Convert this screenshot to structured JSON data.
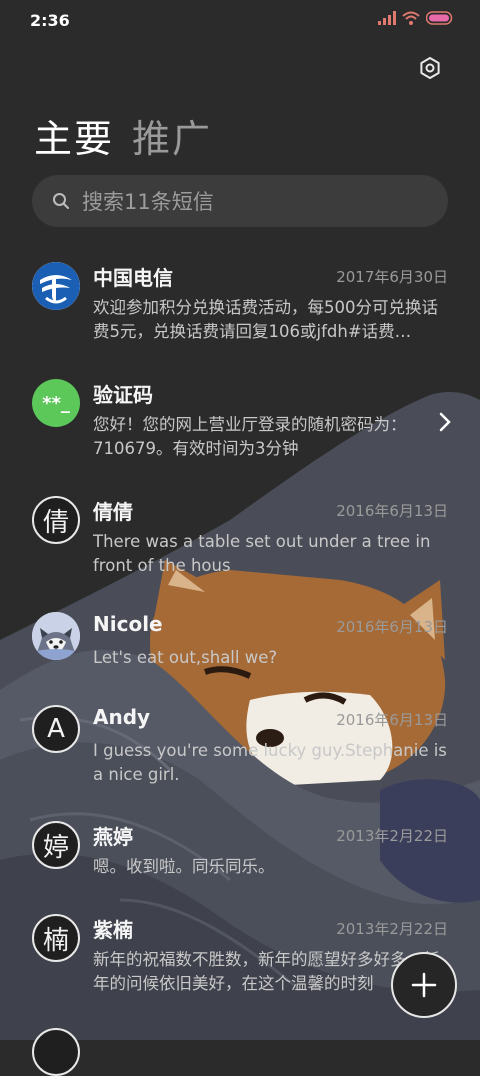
{
  "status_bar": {
    "time": "2:36"
  },
  "tabs": {
    "primary": "主要",
    "promo": "推广"
  },
  "search": {
    "placeholder": "搜索11条短信"
  },
  "messages": [
    {
      "sender": "中国电信",
      "date": "2017年6月30日",
      "preview": "欢迎参加积分兑换话费活动，每500分可兑换话费5元，兑换话费请回复106或jfdh#话费…",
      "avatar": "china-telecom-logo"
    },
    {
      "sender": "验证码",
      "date": "",
      "preview": "您好！您的网上营业厅登录的随机密码为：710679。有效时间为3分钟",
      "avatar_text": "**_"
    },
    {
      "sender": "倩倩",
      "date": "2016年6月13日",
      "preview": "There was a table set out under a tree in front of the hous",
      "avatar_text": "倩"
    },
    {
      "sender": "Nicole",
      "date": "2016年6月13日",
      "preview": "Let's eat out,shall we?",
      "avatar": "husky-photo"
    },
    {
      "sender": "Andy",
      "date": "2016年6月13日",
      "preview": "I guess you're some lucky guy.Stephanie is a nice girl.",
      "avatar_text": "A"
    },
    {
      "sender": "燕婷",
      "date": "2013年2月22日",
      "preview": "嗯。收到啦。同乐同乐。",
      "avatar_text": "婷"
    },
    {
      "sender": "紫楠",
      "date": "2013年2月22日",
      "preview": "新年的祝福数不胜数，新年的愿望好多好多，新年的问候依旧美好，在这个温馨的时刻",
      "avatar_text": "楠"
    }
  ],
  "colors": {
    "background": "#2b2b2b",
    "verification_avatar": "#5cc85a",
    "telecom_blue": "#1b5fb4"
  }
}
